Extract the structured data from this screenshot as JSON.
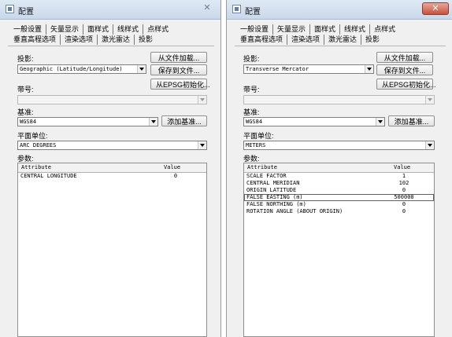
{
  "left": {
    "window_title": "配置",
    "close_label": "✕",
    "tabs_row1": [
      "一般设置",
      "矢量显示",
      "面样式",
      "线样式",
      "点样式"
    ],
    "tabs_row2": [
      "垂直高程选项",
      "渲染选项",
      "激光雷达",
      "投影"
    ],
    "projection_label": "投影:",
    "projection_value": "Geographic (Latitude/Longitude)",
    "load_file_button": "从文件加载...",
    "save_file_button": "保存到文件...",
    "epsg_button": "从EPSG初始化...",
    "zone_label": "带号:",
    "zone_value": "",
    "datum_label": "基准:",
    "datum_value": "WGS84",
    "add_datum_button": "添加基准...",
    "unit_label": "平面单位:",
    "unit_value": "ARC DEGREES",
    "params_label": "参数:",
    "columns": {
      "attribute": "Attribute",
      "value": "Value"
    },
    "rows": [
      {
        "attribute": "CENTRAL LONGITUDE",
        "value": "0"
      }
    ]
  },
  "right": {
    "window_title": "配置",
    "close_label": "✕",
    "tabs_row1": [
      "一般设置",
      "矢量显示",
      "面样式",
      "线样式",
      "点样式"
    ],
    "tabs_row2": [
      "垂直高程选项",
      "渲染选项",
      "激光雷达",
      "投影"
    ],
    "projection_label": "投影:",
    "projection_value": "Transverse Mercator",
    "load_file_button": "从文件加载...",
    "save_file_button": "保存到文件...",
    "epsg_button": "从EPSG初始化...",
    "zone_label": "带号:",
    "zone_value": "",
    "datum_label": "基准:",
    "datum_value": "WGS84",
    "add_datum_button": "添加基准...",
    "unit_label": "平面单位:",
    "unit_value": "METERS",
    "params_label": "参数:",
    "columns": {
      "attribute": "Attribute",
      "value": "Value"
    },
    "rows": [
      {
        "attribute": "SCALE FACTOR",
        "value": "1"
      },
      {
        "attribute": "CENTRAL MERIDIAN",
        "value": "102"
      },
      {
        "attribute": "ORIGIN LATITUDE",
        "value": "0"
      },
      {
        "attribute": "FALSE EASTING (m)",
        "value": "500000"
      },
      {
        "attribute": "FALSE NORTHING (m)",
        "value": "0"
      },
      {
        "attribute": "ROTATION ANGLE (ABOUT ORIGIN)",
        "value": "0"
      }
    ],
    "selected_row": 3
  },
  "colors": {
    "titlebar": "#c9d8ea",
    "close_active": "#c8513b",
    "dialog_bg": "#f0f0f0"
  }
}
